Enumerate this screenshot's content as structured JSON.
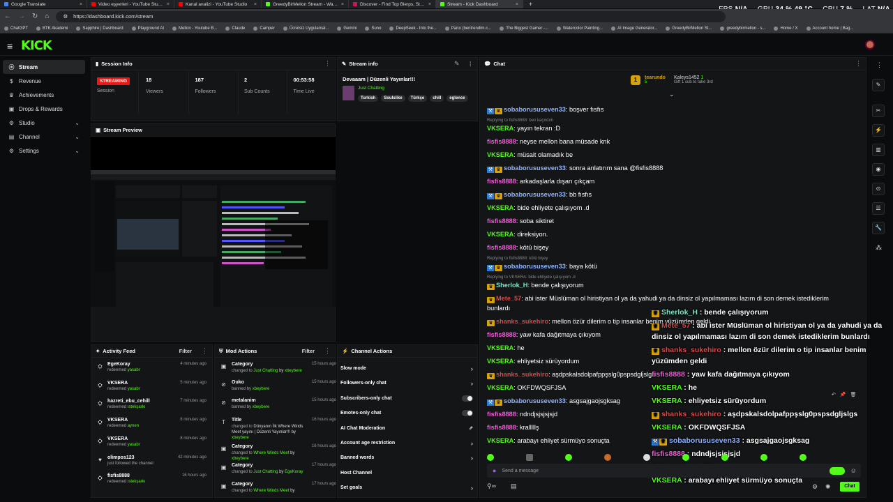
{
  "browser": {
    "tabs": [
      {
        "title": "Google Translate",
        "color": "#4285f4"
      },
      {
        "title": "Video eşyerleri - YouTube Studio",
        "color": "#ff0000"
      },
      {
        "title": "Kanal analizi - YouTube Studio",
        "color": "#ff0000"
      },
      {
        "title": "GreedyBirMellon Stream - Watch...",
        "color": "#53fc18"
      },
      {
        "title": "Discover - Find Top Blerps, Stre...",
        "color": "#c2185b"
      },
      {
        "title": "Stream - Kick Dashboard",
        "color": "#53fc18"
      }
    ],
    "url": "https://dashboard.kick.com/stream",
    "bookmarks": [
      "ChatGPT",
      "BTK Akademi",
      "Sapphire | Dashboard",
      "Playground AI",
      "Mellon - Youtube B...",
      "Claude",
      "Camper",
      "Ücretsiz Uygulamal...",
      "Gemini",
      "Suno",
      "DeepSeek - Into the...",
      "Pano (bentrendim.c...",
      "The Biggest Gamer -...",
      "Watercolor Painting...",
      "AI Image Generator...",
      "GreedyBirMellon St...",
      "greedybirmellon - s...",
      "Home / X",
      "Account home | Bag..."
    ]
  },
  "hud": {
    "fps_label": "FPS",
    "fps": "N/A",
    "gpu_label": "GPU",
    "gpu": "34 % 49 °C",
    "cpu_label": "CPU",
    "cpu": "7 %",
    "lat_label": "LAT",
    "lat": "N/A"
  },
  "logo": "KICK",
  "sidebar": {
    "items": [
      {
        "label": "Stream",
        "icon": "stream-icon"
      },
      {
        "label": "Revenue",
        "icon": "dollar-icon"
      },
      {
        "label": "Achievements",
        "icon": "trophy-icon"
      },
      {
        "label": "Drops & Rewards",
        "icon": "gift-icon"
      },
      {
        "label": "Studio",
        "icon": "studio-icon"
      },
      {
        "label": "Channel",
        "icon": "channel-icon"
      },
      {
        "label": "Settings",
        "icon": "gear-icon"
      }
    ]
  },
  "session": {
    "title": "Session Info",
    "status": "STREAMING",
    "status_label": "Session",
    "stats": [
      {
        "value": "18",
        "label": "Viewers"
      },
      {
        "value": "187",
        "label": "Followers"
      },
      {
        "value": "2",
        "label": "Sub Counts"
      },
      {
        "value": "00:53:58",
        "label": "Time Live"
      }
    ]
  },
  "stream_info": {
    "title": "Stream info",
    "stream_title": "Devaaam | Düzenli Yayınlar!!!",
    "category": "Just Chatting",
    "tags": [
      "Turkish",
      "Soulslike",
      "Türkçe",
      "chill",
      "eglence"
    ]
  },
  "preview": {
    "title": "Stream Preview"
  },
  "activity": {
    "title": "Activity Feed",
    "filter": "Filter",
    "items": [
      {
        "name": "EgeKoray",
        "sub": "redeemed",
        "target": "yasabr",
        "time": "4 minutes ago",
        "icon": "redeem-icon"
      },
      {
        "name": "VKSERA",
        "sub": "redeemed",
        "target": "yasabr",
        "time": "5 minutes ago",
        "icon": "redeem-icon"
      },
      {
        "name": "hazreti_ebu_cehill",
        "sub": "redeemed",
        "target": "ıstekşarkı",
        "time": "7 minutes ago",
        "icon": "redeem-icon"
      },
      {
        "name": "VKSERA",
        "sub": "redeemed",
        "target": "aynen",
        "time": "8 minutes ago",
        "icon": "redeem-icon"
      },
      {
        "name": "VKSERA",
        "sub": "redeemed",
        "target": "yasabr",
        "time": "8 minutes ago",
        "icon": "redeem-icon"
      },
      {
        "name": "olimpos123",
        "sub": "just followed the channel",
        "target": "",
        "time": "42 minutes ago",
        "icon": "heart-icon"
      },
      {
        "name": "fisfis8888",
        "sub": "redeemed",
        "target": "ıstekşarkı",
        "time": "16 hours ago",
        "icon": "redeem-icon"
      }
    ]
  },
  "mod_actions": {
    "title": "Mod Actions",
    "filter": "Filter",
    "items": [
      {
        "title": "Category",
        "pre": "changed to",
        "hl": "Just Chatting",
        "mid": "by",
        "by": "xbeybere",
        "time": "15 hours ago",
        "icon": "category-icon"
      },
      {
        "title": "Ouko",
        "pre": "banned by",
        "hl": "",
        "mid": "",
        "by": "xbeybere",
        "time": "15 hours ago",
        "icon": "ban-icon"
      },
      {
        "title": "metalanim",
        "pre": "banned by",
        "hl": "",
        "mid": "",
        "by": "xbeybere",
        "time": "15 hours ago",
        "icon": "ban-icon"
      },
      {
        "title": "Title",
        "pre": "changed to",
        "hl": "",
        "mid": "Dünyanın İlk Where Winds Meet yayını | Düzenli Yayınlar!!! by",
        "by": "xbeybere",
        "time": "16 hours ago",
        "icon": "title-icon"
      },
      {
        "title": "Category",
        "pre": "changed to",
        "hl": "Where Winds Meet",
        "mid": "by",
        "by": "xbeybere",
        "time": "16 hours ago",
        "icon": "category-icon"
      },
      {
        "title": "Category",
        "pre": "changed to",
        "hl": "Just Chatting",
        "mid": "by",
        "by": "EgeKoray",
        "time": "17 hours ago",
        "icon": "category-icon"
      },
      {
        "title": "Category",
        "pre": "changed to",
        "hl": "Where Winds Meet",
        "mid": "by",
        "by": "",
        "time": "17 hours ago",
        "icon": "category-icon"
      }
    ]
  },
  "channel_actions": {
    "title": "Channel Actions",
    "items": [
      {
        "label": "Slow mode",
        "kind": "chevron"
      },
      {
        "label": "Followers-only chat",
        "kind": "chevron"
      },
      {
        "label": "Subscribers-only chat",
        "kind": "toggle"
      },
      {
        "label": "Emotes-only chat",
        "kind": "toggle"
      },
      {
        "label": "AI Chat Moderation",
        "kind": "external"
      },
      {
        "label": "Account age restriction",
        "kind": "chevron"
      },
      {
        "label": "Banned words",
        "kind": "chevron"
      },
      {
        "label": "Host Channel",
        "kind": "none"
      },
      {
        "label": "Set goals",
        "kind": "chevron"
      }
    ]
  },
  "chat": {
    "title": "Chat",
    "gifters": {
      "first": "tearundo",
      "first_count": "5",
      "second": "Kaleys1452",
      "second_count": "1",
      "gift_text": "Gift 1 sub to take 3rd"
    },
    "messages": [
      {
        "user": "sobaborususeven33",
        "color": "c-blue",
        "badges": "modvip",
        "text": ": boşver fısfıs"
      },
      {
        "reply": "Replying to fisfis8888: ben kaçırdım"
      },
      {
        "user": "VKSERA",
        "color": "c-green",
        "badges": "",
        "text": ": yayın tekran :D"
      },
      {
        "user": "fisfis8888",
        "color": "c-pink",
        "badges": "",
        "text": ": neyse mellon bana müsade knk"
      },
      {
        "user": "VKSERA",
        "color": "c-green",
        "badges": "",
        "text": ": müsait olamadık be"
      },
      {
        "user": "sobaborususeven33",
        "color": "c-blue",
        "badges": "modvip",
        "text": ": sonra anlatırım sana @fisfis8888"
      },
      {
        "user": "fisfis8888",
        "color": "c-pink",
        "badges": "",
        "text": ": arkadaşlarla dışarı çıkçam"
      },
      {
        "user": "sobaborususeven33",
        "color": "c-blue",
        "badges": "modvip",
        "text": ": bb fısfıs"
      },
      {
        "user": "VKSERA",
        "color": "c-green",
        "badges": "",
        "text": ": bide ehliyete çalışıyom .d"
      },
      {
        "user": "fisfis8888",
        "color": "c-pink",
        "badges": "",
        "text": ": soba siktiret"
      },
      {
        "user": "VKSERA",
        "color": "c-green",
        "badges": "",
        "text": ": direksiyon."
      },
      {
        "user": "fisfis8888",
        "color": "c-pink",
        "badges": "",
        "text": ": kötü bişey"
      },
      {
        "reply": "Replying to fisfis8888: kötü bişey"
      },
      {
        "user": "sobaborususeven33",
        "color": "c-blue",
        "badges": "modvip",
        "text": ": baya kötü"
      },
      {
        "reply": "Replying to VKSERA: bide ehliyete çalışıyom .d"
      },
      {
        "user": "Sherlok_H",
        "color": "c-mint",
        "badges": "vip",
        "text": ": bende çalışıyorum"
      },
      {
        "user": "Mete_57",
        "color": "c-red",
        "badges": "vip",
        "text": ": abi ister Müslüman ol hiristiyan ol ya da yahudi ya da dinsiz ol yapılmaması lazım di son demek istediklerim"
      },
      {
        "cont": "bunlardı"
      },
      {
        "user": "shanks_sukehiro",
        "color": "c-red",
        "badges": "vip",
        "text": ": mellon özür dilerim o tip insanlar benim yüzümden geldi"
      },
      {
        "user": "fisfis8888",
        "color": "c-pink",
        "badges": "",
        "text": ": yaw kafa dağıtmaya çıkıyom"
      },
      {
        "user": "VKSERA",
        "color": "c-green",
        "badges": "",
        "text": ": he"
      },
      {
        "user": "VKSERA",
        "color": "c-green",
        "badges": "",
        "text": ": ehliyetsiz sürüyordum"
      },
      {
        "user": "shanks_sukehiro",
        "color": "c-red",
        "badges": "vip",
        "text": ": aşdpskalsdolpafppşslg0pspsdglj̇slgs"
      },
      {
        "user": "VKSERA",
        "color": "c-green",
        "badges": "",
        "text": ": OKFDWQSFJSA"
      },
      {
        "user": "sobaborususeven33",
        "color": "c-blue",
        "badges": "modvip",
        "text": ": asgsajgaojsgksag"
      },
      {
        "user": "fisfis8888",
        "color": "c-pink",
        "badges": "",
        "text": ": ndndjsjsjsjsjd"
      },
      {
        "user": "fisfis8888",
        "color": "c-pink",
        "badges": "",
        "text": ": kralllllş"
      },
      {
        "user": "VKSERA",
        "color": "c-green",
        "badges": "",
        "text": ": arabayı ehliyet sürmüyo sonuçta"
      }
    ],
    "overlay": [
      {
        "user": "Sherlok_H",
        "color": "c-mint",
        "badges": "vip",
        "text": " : bende çalışıyorum"
      },
      {
        "user": "Mete_57",
        "color": "c-red",
        "badges": "vip",
        "text": " : abi ister Müslüman ol hiristiyan ol ya da yahudi ya da"
      },
      {
        "cont": "dinsiz ol yapılmaması lazım di son demek istediklerim bunlardı"
      },
      {
        "user": "shanks_sukehiro",
        "color": "c-red",
        "badges": "vip",
        "text": " : mellon özür dilerim o tip insanlar benim"
      },
      {
        "cont": "yüzümden geldi"
      },
      {
        "user": "fisfis8888",
        "color": "c-pink",
        "badges": "",
        "text": " : yaw kafa dağıtmaya çıkıyom"
      },
      {
        "user": "VKSERA",
        "color": "c-green",
        "badges": "",
        "text": " : he"
      },
      {
        "user": "VKSERA",
        "color": "c-green",
        "badges": "",
        "text": " : ehliyetsiz sürüyordum"
      },
      {
        "user": "shanks_sukehiro",
        "color": "c-red",
        "badges": "vip",
        "text": " : aşdpskalsdolpafppşslg0pspsdgljslgs"
      },
      {
        "user": "VKSERA",
        "color": "c-green",
        "badges": "",
        "text": " : OKFDWQSFJSA"
      },
      {
        "user": "sobaborususeven33",
        "color": "c-blue",
        "badges": "modvip",
        "text": " : asgsajgaojsgksag"
      },
      {
        "user": "fisfis8888",
        "color": "c-pink",
        "badges": "",
        "text": " : ndndjsjsjsjsjd"
      },
      {
        "user": "fisfis8888",
        "color": "c-pink",
        "badges": "",
        "text": " : kralllllş"
      },
      {
        "user": "VKSERA",
        "color": "c-green",
        "badges": "",
        "text": " : arabayı ehliyet sürmüyo sonuçta"
      }
    ],
    "input_placeholder": "Send a message",
    "send_label": "Chat"
  },
  "colors": {
    "accent": "#53fc18",
    "live": "#e91916",
    "bg": "#0b0c0e",
    "panel": "#141517"
  }
}
